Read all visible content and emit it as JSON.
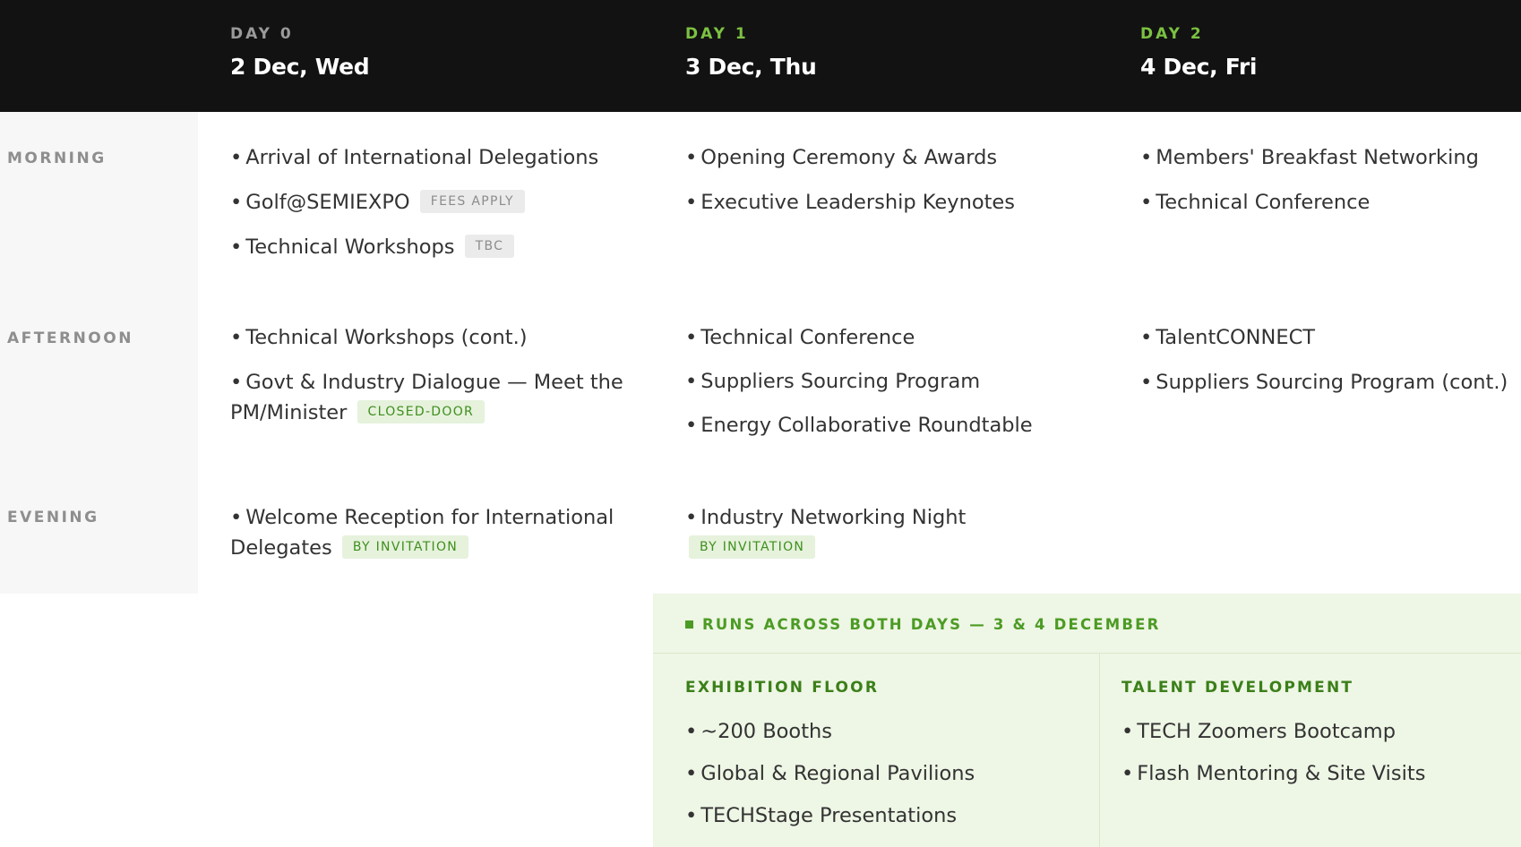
{
  "days": [
    {
      "label": "DAY 0",
      "date": "2 Dec, Wed"
    },
    {
      "label": "DAY 1",
      "date": "3 Dec, Thu"
    },
    {
      "label": "DAY 2",
      "date": "4 Dec, Fri"
    }
  ],
  "periods": {
    "morning": "MORNING",
    "afternoon": "AFTERNOON",
    "evening": "EVENING"
  },
  "bullet": "•",
  "schedule": {
    "morning": {
      "day0": [
        {
          "text": "Arrival of International Delegations"
        },
        {
          "text": "Golf@SEMIEXPO",
          "badge": "FEES APPLY"
        },
        {
          "text": "Technical Workshops",
          "badge": "TBC"
        }
      ],
      "day1": [
        {
          "text": "Opening Ceremony & Awards"
        },
        {
          "text": "Executive Leadership Keynotes"
        }
      ],
      "day2": [
        {
          "text": "Members' Breakfast Networking"
        },
        {
          "text": "Technical Conference"
        }
      ]
    },
    "afternoon": {
      "day0": [
        {
          "text": "Technical Workshops (cont.)"
        },
        {
          "text": "Govt & Industry Dialogue — Meet the PM/Minister",
          "badge": "CLOSED-DOOR"
        }
      ],
      "day1": [
        {
          "text": "Technical Conference"
        },
        {
          "text": "Suppliers Sourcing Program"
        },
        {
          "text": "Energy Collaborative Roundtable"
        }
      ],
      "day2": [
        {
          "text": "TalentCONNECT"
        },
        {
          "text": "Suppliers Sourcing Program (cont.)"
        }
      ]
    },
    "evening": {
      "day0": [
        {
          "text": "Welcome Reception for International Delegates",
          "badge": "BY INVITATION"
        }
      ],
      "day1": [
        {
          "text": "Industry Networking Night",
          "badge": "BY INVITATION"
        }
      ]
    }
  },
  "both_days": {
    "heading": "RUNS ACROSS BOTH DAYS — 3 & 4 DECEMBER",
    "exhibition": {
      "title": "EXHIBITION FLOOR",
      "items": [
        "~200 Booths",
        "Global & Regional Pavilions",
        "TECHStage Presentations"
      ]
    },
    "talent": {
      "title": "TALENT DEVELOPMENT",
      "items": [
        "TECH Zoomers Bootcamp",
        "Flash Mentoring & Site Visits"
      ]
    }
  },
  "colors": {
    "header_bg": "#121212",
    "accent_green": "#7cc142",
    "badge_green_text": "#3f8f1f",
    "panel_bg": "#eef6e5"
  }
}
